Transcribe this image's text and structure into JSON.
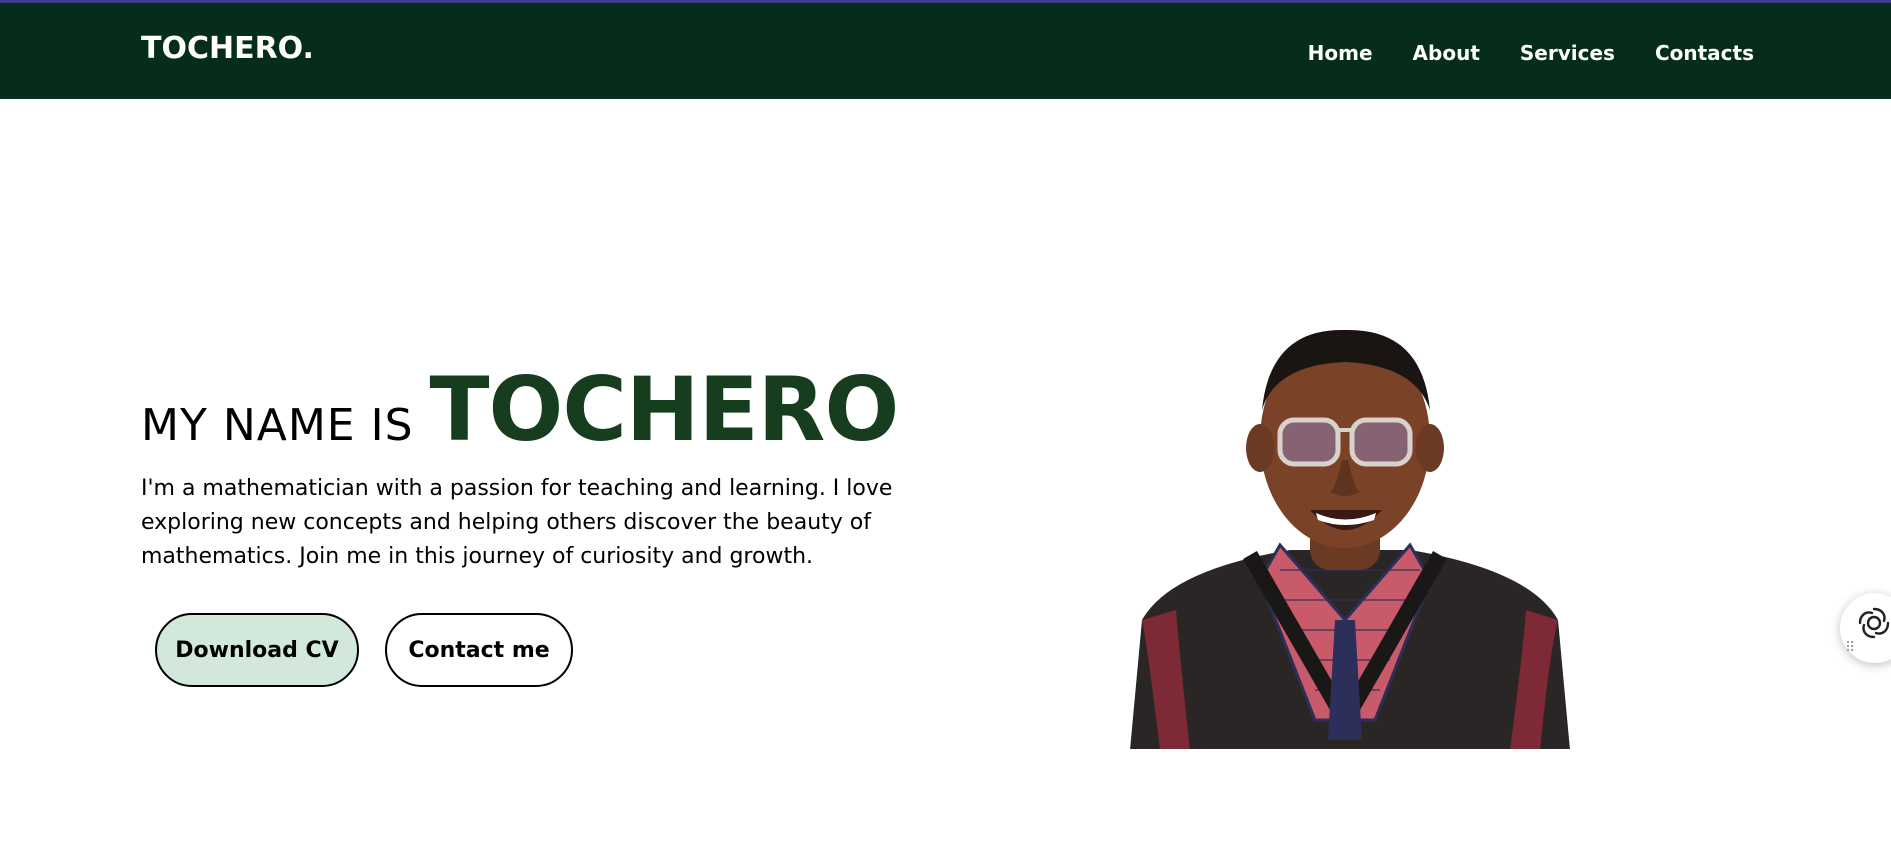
{
  "header": {
    "logo": "TOCHERO.",
    "nav": [
      {
        "label": "Home"
      },
      {
        "label": "About"
      },
      {
        "label": "Services"
      },
      {
        "label": "Contacts"
      }
    ]
  },
  "hero": {
    "prefix": "MY NAME IS",
    "name": "TOCHERO",
    "bio": "I'm a mathematician with a passion for teaching and learning. I love exploring new concepts and helping others discover the beauty of mathematics. Join me in this journey of curiosity and growth.",
    "buttons": {
      "download": "Download CV",
      "contact": "Contact me"
    }
  },
  "colors": {
    "nav_bg": "#062d1a",
    "accent_green": "#173d1f",
    "primary_button_bg": "#d2e8db"
  },
  "icons": {
    "floating": "assistant-swirl-icon"
  }
}
